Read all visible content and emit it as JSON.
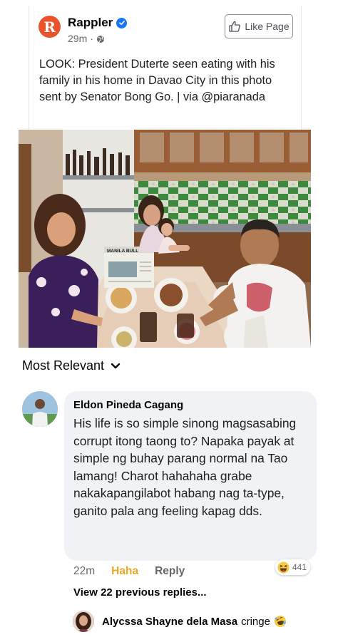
{
  "post": {
    "page_name": "Rappler",
    "page_initial": "R",
    "timestamp": "29m",
    "separator": "·",
    "like_page_label": "Like Page",
    "text": "LOOK: President Duterte seen eating with his family in his home in Davao City in this photo sent by Senator Bong Go. | via @piaranada",
    "newspaper_masthead": "MANILA BULLETIN"
  },
  "comments": {
    "sort_label": "Most Relevant",
    "top_comment": {
      "author": "Eldon Pineda Cagang",
      "text": "His life  is so simple sinong magsasabing corrupt itong taong to? Napaka payak at simple ng buhay parang normal na Tao lamang! Charot hahahaha grabe nakakapangilabot habang nag ta-type, ganito pala ang feeling kapag dds.",
      "time": "22m",
      "haha_label": "Haha",
      "reply_label": "Reply",
      "reaction_count": "441"
    },
    "view_replies_label": "View 22 previous replies...",
    "latest_reply": {
      "author": "Alycssa Shayne dela Masa",
      "text": "cringe"
    }
  },
  "colors": {
    "brand_orange": "#e8532c",
    "facebook_blue": "#1877f2",
    "haha_yellow": "#e9a823",
    "bubble_gray": "#f0f2f5",
    "meta_gray": "#65676b"
  },
  "icons": {
    "verified": "verified-badge-icon",
    "audience": "globe-icon",
    "like": "thumbs-up-icon",
    "sort": "chevron-down-icon",
    "reaction": "haha-emoji-icon",
    "reply_emoji": "rofl-emoji-icon"
  }
}
